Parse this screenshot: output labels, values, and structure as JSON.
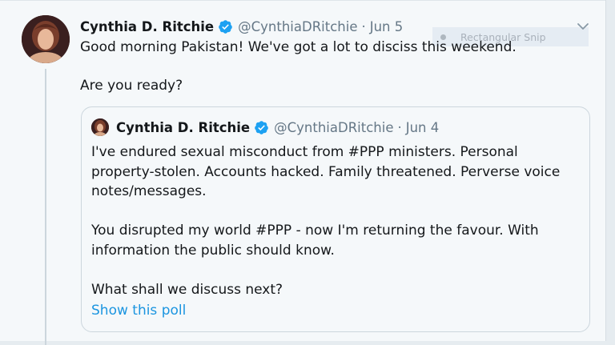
{
  "tweet": {
    "author_name": "Cynthia D. Ritchie",
    "handle": "@CynthiaDRitchie",
    "separator": "·",
    "date": "Jun 5",
    "text": "Good morning Pakistan! We've got a lot to disciss this weekend.\n\nAre you ready?"
  },
  "quoted_tweet": {
    "author_name": "Cynthia D. Ritchie",
    "handle": "@CynthiaDRitchie",
    "separator": "·",
    "date": "Jun 4",
    "text": "I've endured sexual misconduct from #PPP ministers. Personal property-stolen. Accounts hacked. Family threatened. Perverse voice notes/messages.\n\nYou disrupted my world #PPP - now I'm returning the favour. With information the public should know.\n\nWhat shall we discuss next?",
    "poll_link": "Show this poll"
  },
  "overlay": {
    "snip_label": "Rectangular Snip"
  },
  "colors": {
    "link": "#1b95e0",
    "verified": "#1da1f2",
    "secondary_text": "#657786",
    "background": "#f5f8fa"
  },
  "icons": {
    "verified": "verified-badge-icon",
    "caret": "chevron-down-icon"
  }
}
